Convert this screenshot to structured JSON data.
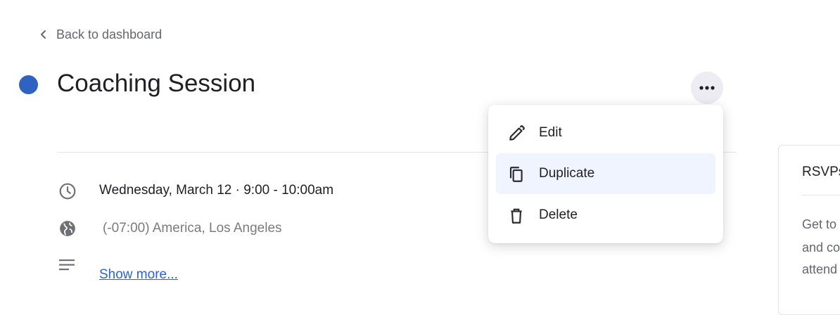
{
  "nav": {
    "back_label": "Back to dashboard"
  },
  "event": {
    "title": "Coaching Session",
    "color": "#2f63c2",
    "datetime": "Wednesday, March 12 · 9:00 - 10:00am",
    "timezone": "(-07:00) America, Los Angeles",
    "show_more": "Show more..."
  },
  "menu": {
    "items": [
      {
        "label": "Edit",
        "icon": "pencil-icon"
      },
      {
        "label": "Duplicate",
        "icon": "copy-icon",
        "highlighted": true
      },
      {
        "label": "Delete",
        "icon": "trash-icon"
      }
    ]
  },
  "side_card": {
    "title": "RSVPs",
    "lines": [
      "Get to",
      "and co",
      "attend"
    ]
  },
  "colors": {
    "accent": "#2f63c2",
    "link": "#2a63d4",
    "menu_highlight": "#eff4ff"
  }
}
